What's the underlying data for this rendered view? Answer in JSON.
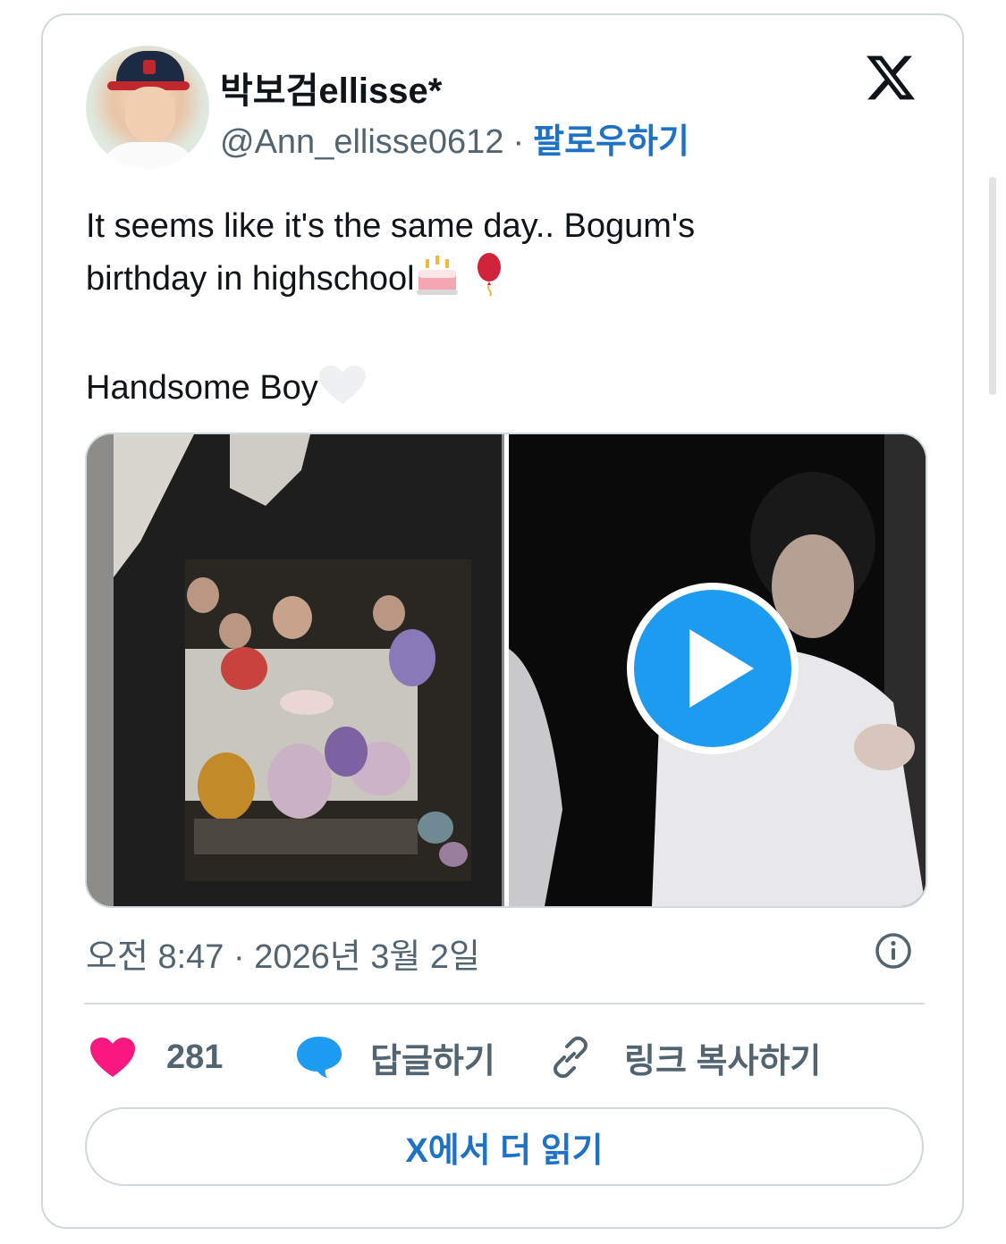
{
  "author": {
    "display_name": "박보검ellisse*",
    "handle": "@Ann_ellisse0612",
    "separator": "·",
    "follow_label": "팔로우하기"
  },
  "tweet": {
    "line1": "It seems like it's the same day.. Bogum's",
    "line2": "birthday in highschool",
    "line3": "Handsome Boy",
    "emojis": [
      "birthday-cake-icon",
      "red-balloon-icon",
      "white-heart-icon"
    ]
  },
  "media": {
    "left": "photo",
    "right": "video",
    "overlay_icon": "play-icon"
  },
  "timestamp": "오전 8:47 · 2026년 3월 2일",
  "actions": {
    "like_count": "281",
    "reply_label": "답글하기",
    "copy_link_label": "링크 복사하기"
  },
  "read_more_label": "X에서 더 읽기",
  "colors": {
    "like": "#f91880",
    "reply": "#1d9bf0",
    "link": "#1d72c6",
    "muted": "#536471",
    "text": "#0f1419",
    "border": "#cfd9de"
  }
}
